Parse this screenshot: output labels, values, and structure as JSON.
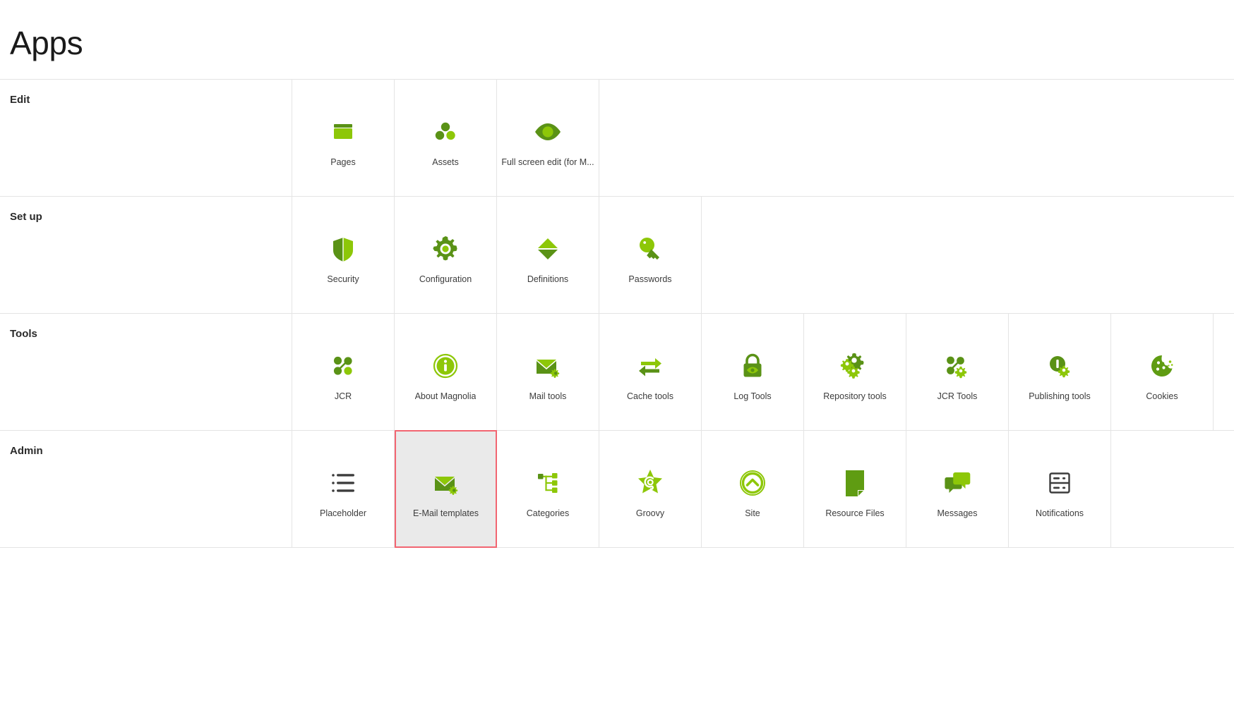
{
  "header": {
    "title": "Apps"
  },
  "colors": {
    "brand_green_light": "#8dc708",
    "brand_green_dark": "#5a9216",
    "selection_border": "#f26571",
    "selection_background": "#eaeaea",
    "grid_line": "#e4e4e4",
    "dark_icon": "#3c3c3c",
    "text": "#3c3c3c"
  },
  "groups": [
    {
      "label": "Edit",
      "apps": [
        {
          "label": "Pages",
          "icon": "pages-icon",
          "selected": false
        },
        {
          "label": "Assets",
          "icon": "assets-icon",
          "selected": false
        },
        {
          "label": "Full screen edit (for M...",
          "icon": "eye-icon",
          "selected": false
        }
      ]
    },
    {
      "label": "Set up",
      "apps": [
        {
          "label": "Security",
          "icon": "shield-icon",
          "selected": false
        },
        {
          "label": "Configuration",
          "icon": "gear-icon",
          "selected": false
        },
        {
          "label": "Definitions",
          "icon": "diamond-icon",
          "selected": false
        },
        {
          "label": "Passwords",
          "icon": "key-icon",
          "selected": false
        }
      ]
    },
    {
      "label": "Tools",
      "apps": [
        {
          "label": "JCR",
          "icon": "node-graph-icon",
          "selected": false
        },
        {
          "label": "About Magnolia",
          "icon": "info-circle-icon",
          "selected": false
        },
        {
          "label": "Mail tools",
          "icon": "mail-gear-icon",
          "selected": false
        },
        {
          "label": "Cache tools",
          "icon": "swap-arrows-icon",
          "selected": false
        },
        {
          "label": "Log Tools",
          "icon": "lock-eye-icon",
          "selected": false
        },
        {
          "label": "Repository tools",
          "icon": "multi-gear-icon",
          "selected": false
        },
        {
          "label": "JCR Tools",
          "icon": "node-graph-gear-icon",
          "selected": false
        },
        {
          "label": "Publishing tools",
          "icon": "publish-gear-icon",
          "selected": false
        },
        {
          "label": "Cookies",
          "icon": "cookie-icon",
          "selected": false
        }
      ]
    },
    {
      "label": "Admin",
      "apps": [
        {
          "label": "Placeholder",
          "icon": "list-icon",
          "selected": false
        },
        {
          "label": "E-Mail templates",
          "icon": "mail-gear-icon",
          "selected": true
        },
        {
          "label": "Categories",
          "icon": "tree-icon",
          "selected": false
        },
        {
          "label": "Groovy",
          "icon": "groovy-star-icon",
          "selected": false
        },
        {
          "label": "Site",
          "icon": "chevron-circle-up-icon",
          "selected": false
        },
        {
          "label": "Resource Files",
          "icon": "document-icon",
          "selected": false
        },
        {
          "label": "Messages",
          "icon": "speech-bubbles-icon",
          "selected": false
        },
        {
          "label": "Notifications",
          "icon": "notifications-rack-icon",
          "selected": false
        }
      ]
    }
  ]
}
